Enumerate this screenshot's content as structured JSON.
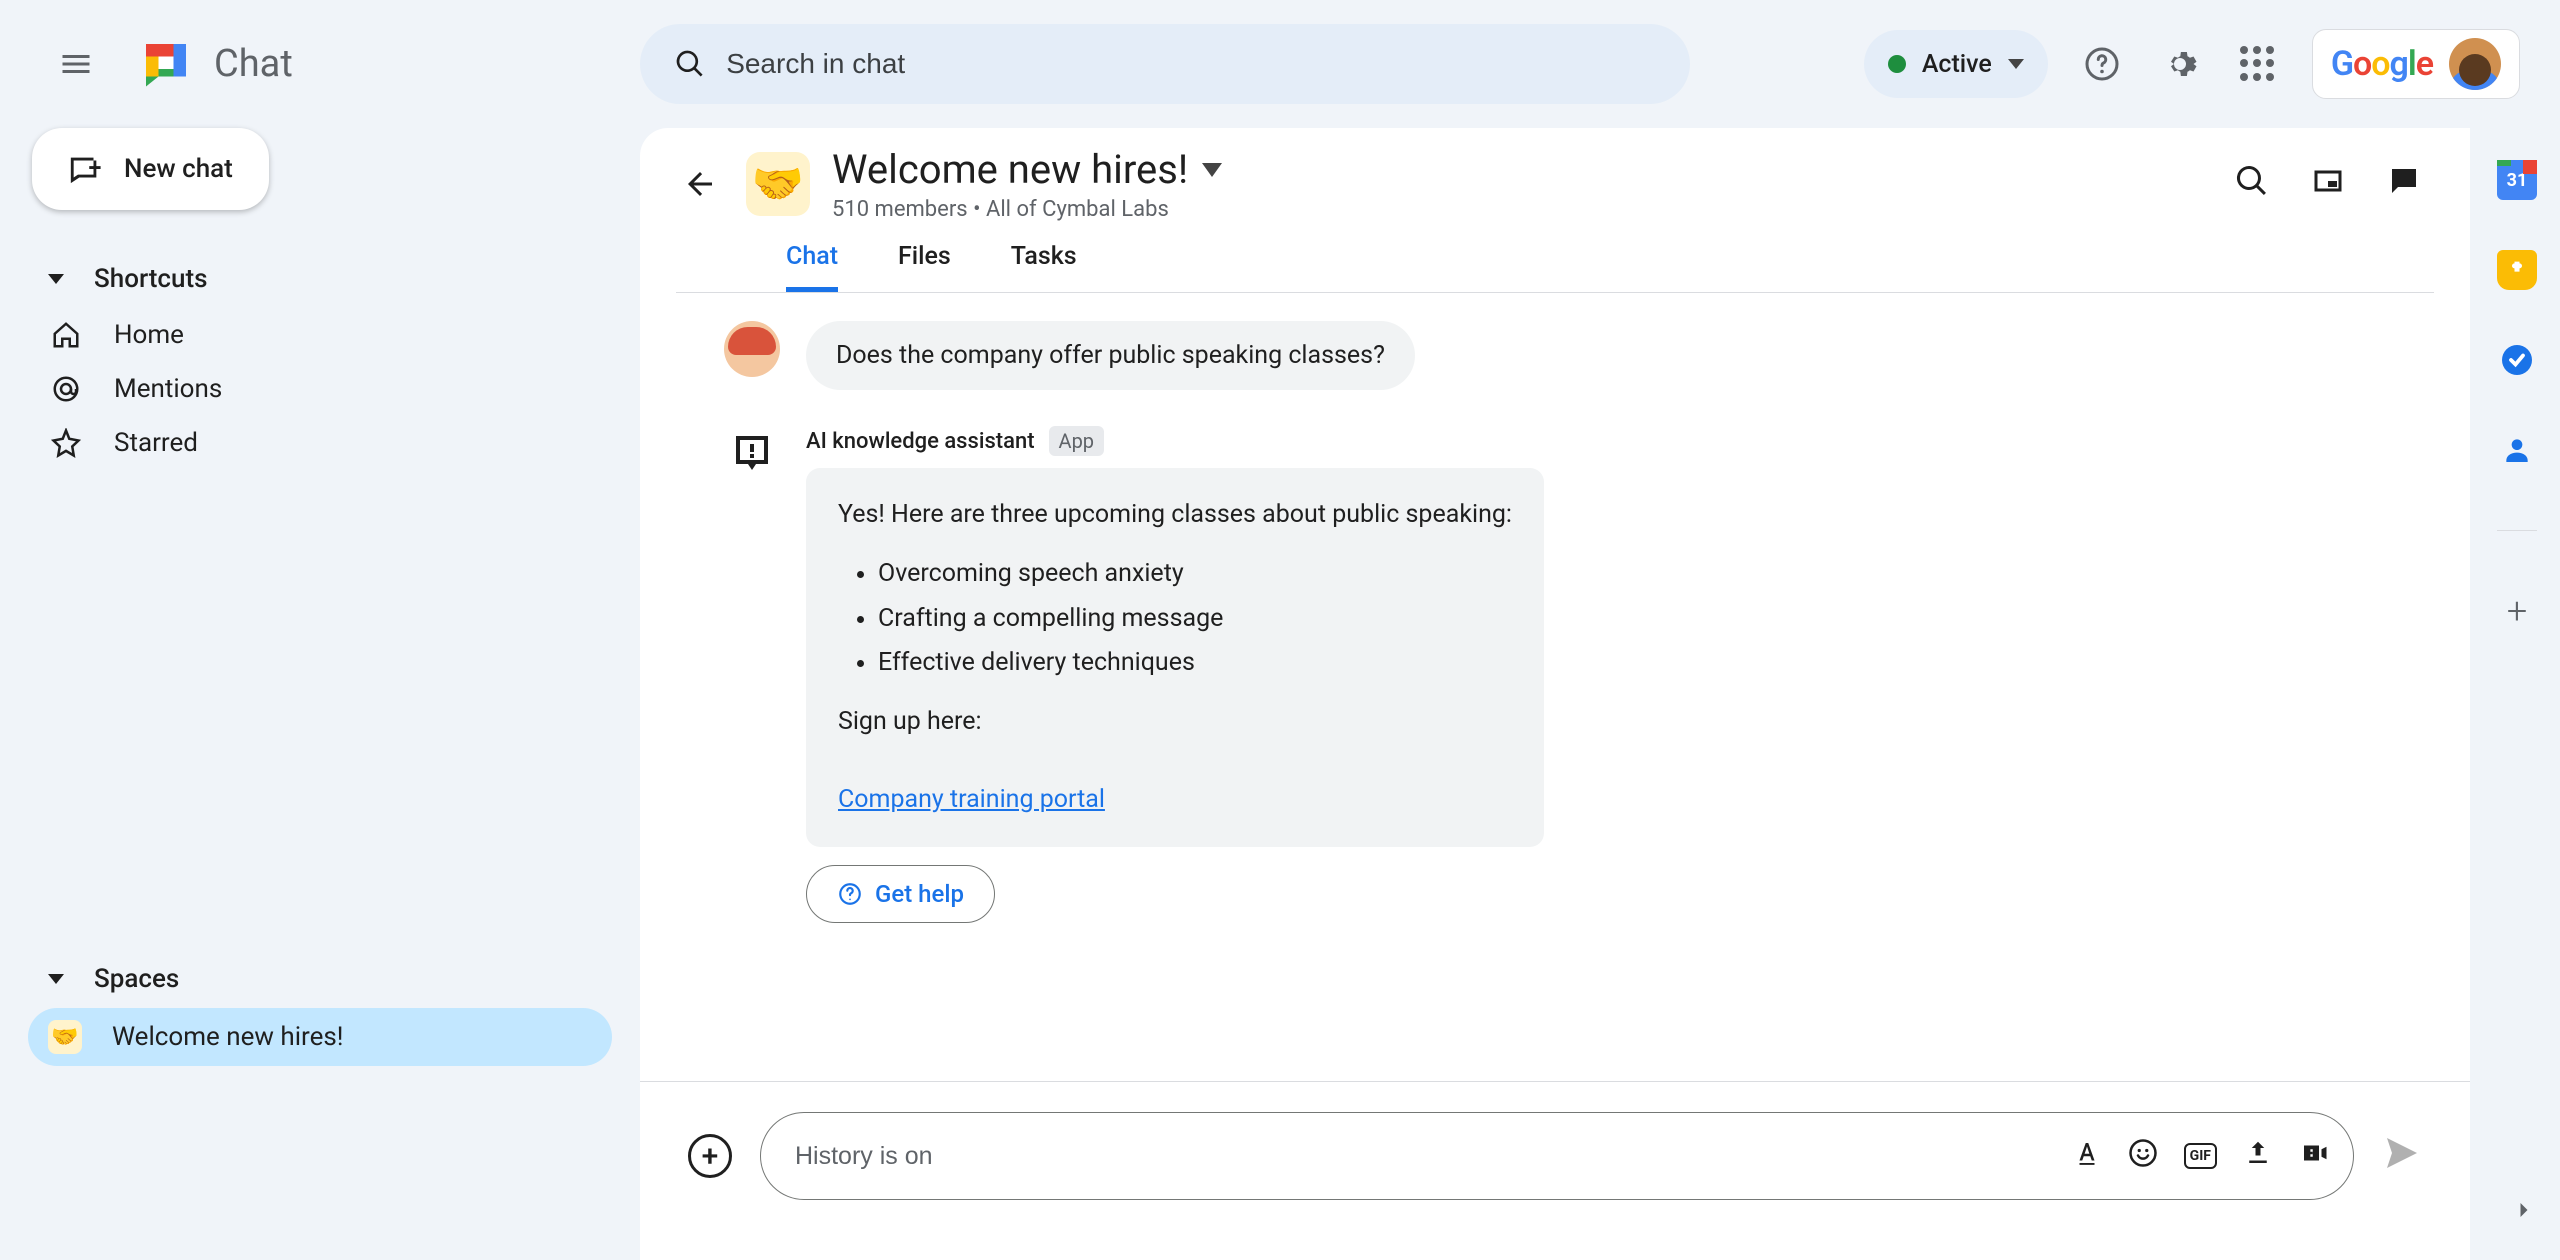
{
  "app": {
    "name": "Chat"
  },
  "search": {
    "placeholder": "Search in chat"
  },
  "status": {
    "label": "Active"
  },
  "new_chat": {
    "label": "New chat"
  },
  "nav": {
    "shortcuts_label": "Shortcuts",
    "home": "Home",
    "mentions": "Mentions",
    "starred": "Starred",
    "spaces_label": "Spaces",
    "space_item": "Welcome new hires!"
  },
  "space": {
    "title": "Welcome new hires!",
    "subtitle": "510 members  •  All of Cymbal Labs",
    "emoji": "🤝"
  },
  "tabs": {
    "chat": "Chat",
    "files": "Files",
    "tasks": "Tasks"
  },
  "messages": {
    "user_question": "Does the company offer public speaking classes?",
    "bot_name": "AI knowledge assistant",
    "app_badge": "App",
    "bot_intro": "Yes! Here are three upcoming classes about public speaking:",
    "class1": "Overcoming speech anxiety",
    "class2": "Crafting a compelling message",
    "class3": "Effective delivery techniques",
    "signup_label": "Sign up here:",
    "portal_link": "Company training portal",
    "get_help": "Get help"
  },
  "compose": {
    "placeholder": "History is on"
  },
  "sidepanel": {
    "calendar_day": "31"
  }
}
